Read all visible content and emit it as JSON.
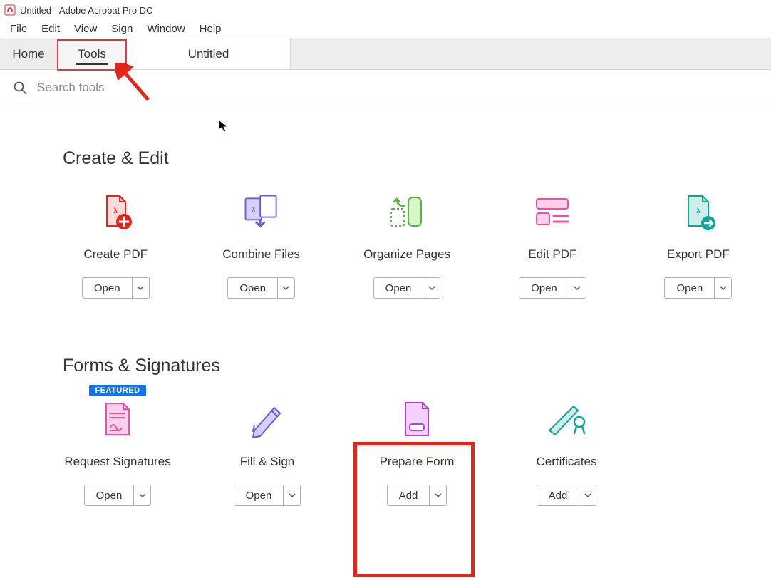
{
  "window": {
    "title": "Untitled - Adobe Acrobat Pro DC"
  },
  "menu": {
    "items": [
      "File",
      "Edit",
      "View",
      "Sign",
      "Window",
      "Help"
    ]
  },
  "tabs": {
    "home": "Home",
    "tools": "Tools",
    "doc": "Untitled"
  },
  "search": {
    "placeholder": "Search tools"
  },
  "sections": [
    {
      "title": "Create & Edit",
      "tools": [
        {
          "label": "Create PDF",
          "action": "Open",
          "icon": "create-pdf"
        },
        {
          "label": "Combine Files",
          "action": "Open",
          "icon": "combine-files"
        },
        {
          "label": "Organize Pages",
          "action": "Open",
          "icon": "organize-pages"
        },
        {
          "label": "Edit PDF",
          "action": "Open",
          "icon": "edit-pdf"
        },
        {
          "label": "Export PDF",
          "action": "Open",
          "icon": "export-pdf"
        }
      ]
    },
    {
      "title": "Forms & Signatures",
      "tools": [
        {
          "label": "Request Signatures",
          "action": "Open",
          "icon": "request-signatures",
          "featured": "FEATURED"
        },
        {
          "label": "Fill & Sign",
          "action": "Open",
          "icon": "fill-sign"
        },
        {
          "label": "Prepare Form",
          "action": "Add",
          "icon": "prepare-form",
          "highlighted": true
        },
        {
          "label": "Certificates",
          "action": "Add",
          "icon": "certificates"
        }
      ]
    }
  ]
}
